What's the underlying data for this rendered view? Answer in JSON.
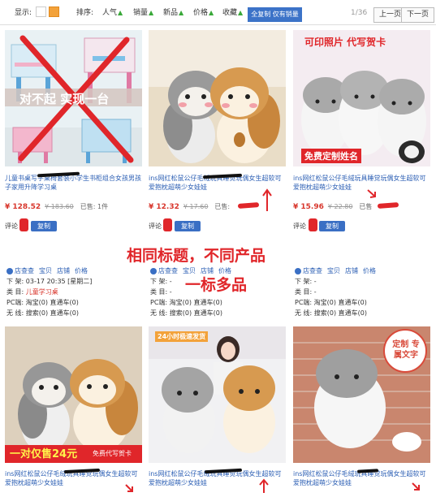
{
  "toolbar": {
    "display_label": "显示:",
    "sort_label": "排序:",
    "sort_options": [
      "人气",
      "销量",
      "新品",
      "价格",
      "收藏"
    ],
    "filter_button": "全复制 仅有销量",
    "page_indicator": "1/36",
    "prev_button": "上一页",
    "next_button": "下一页"
  },
  "products": [
    {
      "image_caption": "对不起 实现一台",
      "title": "儿童书桌写字桌椅套装小学生书柜组合女孩男孩子家用升降学习桌",
      "price": "¥ 128.52",
      "old_price": "¥ 183.60",
      "sold": "已售: 1件",
      "review_label": "评论",
      "copy_button": "复制",
      "tabs": [
        "店查查",
        "宝贝",
        "店铺",
        "价格"
      ],
      "listed": "下 架: 03-17 20:35 [星期二]",
      "category_label": "类 目: ",
      "category": "儿童学习桌",
      "pc": "PC端: 淘宝(0) 直通车(0)",
      "wireless": "无 线: 搜索(0) 直通车(0)"
    },
    {
      "title": "ins网红松鼠公仔毛绒玩具睡觉玩偶女生超软可爱抱枕超萌少女娃娃",
      "price": "¥ 12.32",
      "old_price": "¥ 17.60",
      "sold": "已售:",
      "review_label": "评论",
      "copy_button": "复制",
      "tabs": [
        "店查查",
        "宝贝",
        "店铺",
        "价格"
      ],
      "listed": "下 架: -",
      "category_label": "类 目: -",
      "pc": "PC端: 淘宝(0) 直通车(0)",
      "wireless": "无 线: 搜索(0) 直通车(0)"
    },
    {
      "image_caption_top": "可印照片 代写贺卡",
      "image_caption_bottom": "免费定制姓名",
      "title": "ins网红松鼠公仔毛绒玩具睡觉玩偶女生超软可爱抱枕超萌少女娃娃",
      "price": "¥ 15.96",
      "old_price": "¥ 22.80",
      "sold": "已售",
      "review_label": "评论",
      "copy_button": "复制",
      "tabs": [
        "店查查",
        "宝贝",
        "店铺",
        "价格"
      ],
      "listed": "下 架: -",
      "category_label": "类 目: -",
      "pc": "PC端: 淘宝(0) 直通车(0)",
      "wireless": "无 线: 搜索(0) 直通车(0)"
    },
    {
      "image_caption": "一对仅售24元",
      "image_caption_small": "免费代写贺卡",
      "title": "ins网红松鼠公仔毛绒玩具睡觉玩偶女生超软可爱抱枕超萌少女娃娃"
    },
    {
      "image_badge": "24小时极速发货",
      "title": "ins网红松鼠公仔毛绒玩具睡觉玩偶女生超软可爱抱枕超萌少女娃娃"
    },
    {
      "image_caption": "定制 专属文字",
      "title": "ins网红松鼠公仔毛绒玩具睡觉玩偶女生超软可爱抱枕超萌少女娃娃"
    }
  ],
  "annotation": {
    "line1": "相同标题，不同产品",
    "line2": "一标多品"
  },
  "colors": {
    "accent_blue": "#3c73c8",
    "price_red": "#d8362c",
    "annotation_red": "#e0262a"
  }
}
